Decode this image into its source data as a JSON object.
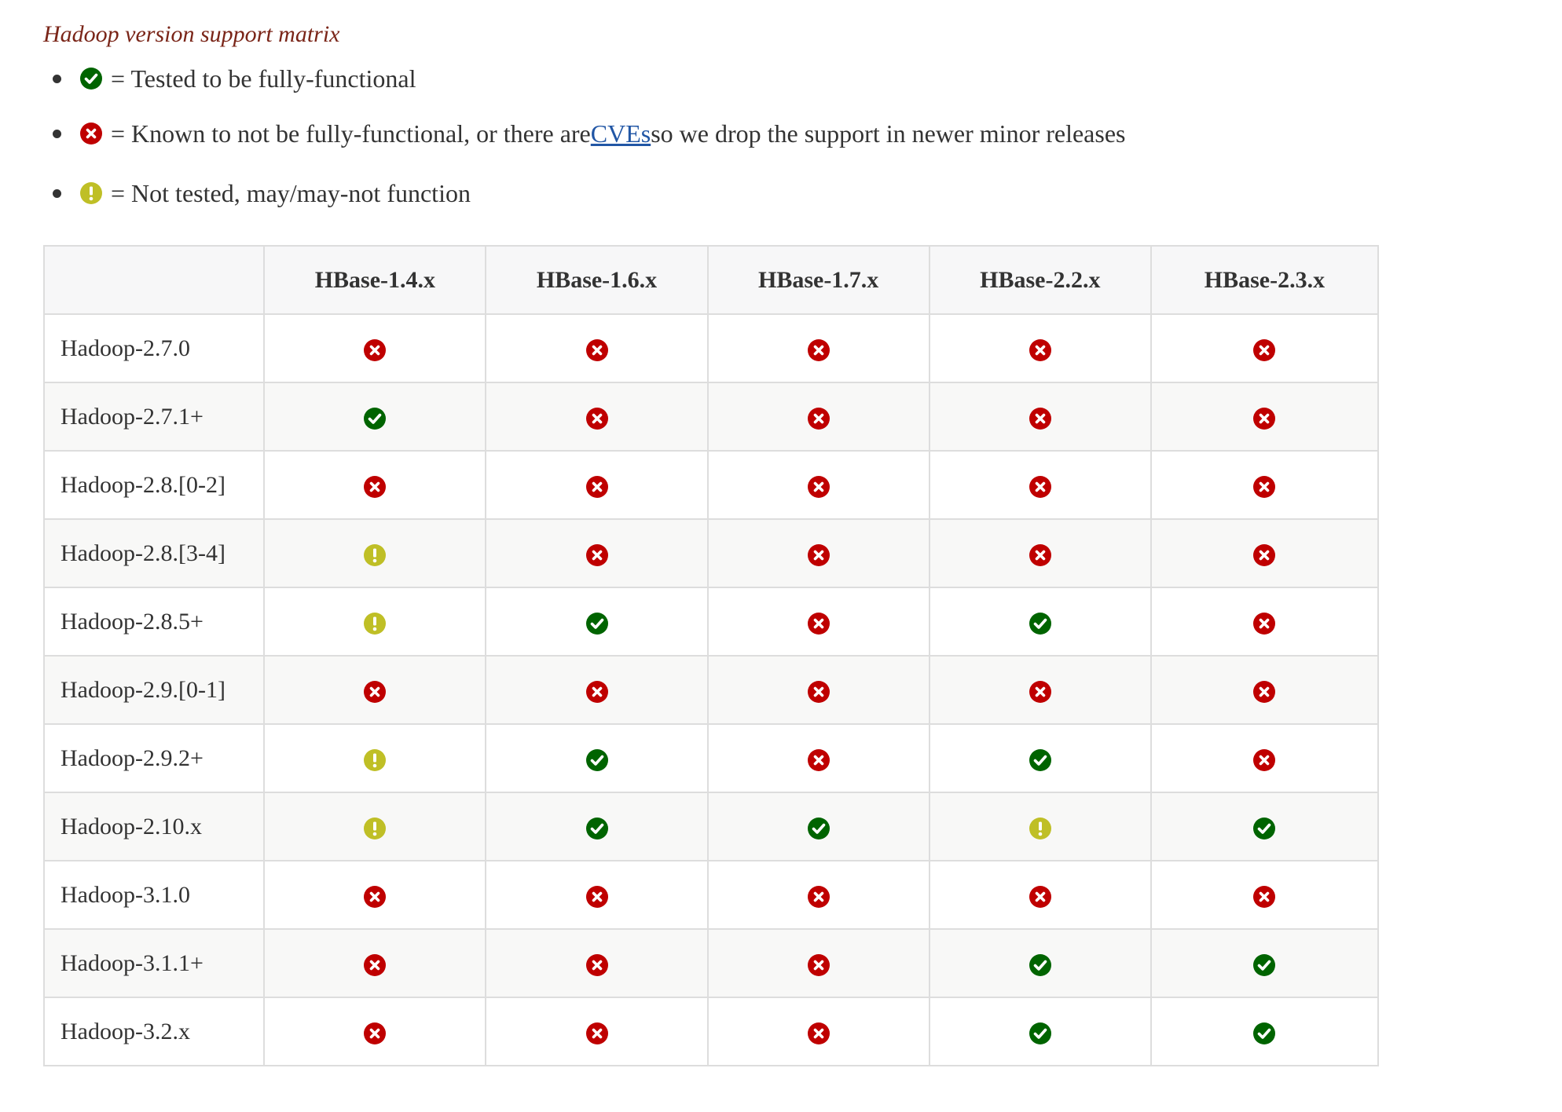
{
  "caption": "Hadoop version support matrix",
  "legend": [
    {
      "icon": "check-circle-icon",
      "pre": "= Tested to be fully-functional",
      "link": "",
      "post": ""
    },
    {
      "icon": "times-circle-icon",
      "pre": "= Known to not be fully-functional, or there are ",
      "link": "CVEs",
      "post": " so we drop the support in newer minor releases"
    },
    {
      "icon": "exclamation-circle-icon",
      "pre": "= Not tested, may/may-not function",
      "link": "",
      "post": ""
    }
  ],
  "colors": {
    "yes": "#006400",
    "no": "#bf0000",
    "untested": "#bfbf26",
    "caption": "#7a2518",
    "link": "#2156a5"
  },
  "table": {
    "columns": [
      "HBase-1.4.x",
      "HBase-1.6.x",
      "HBase-1.7.x",
      "HBase-2.2.x",
      "HBase-2.3.x"
    ],
    "rows": [
      {
        "label": "Hadoop-2.7.0",
        "cells": [
          "no",
          "no",
          "no",
          "no",
          "no"
        ]
      },
      {
        "label": "Hadoop-2.7.1+",
        "cells": [
          "yes",
          "no",
          "no",
          "no",
          "no"
        ]
      },
      {
        "label": "Hadoop-2.8.[0-2]",
        "cells": [
          "no",
          "no",
          "no",
          "no",
          "no"
        ]
      },
      {
        "label": "Hadoop-2.8.[3-4]",
        "cells": [
          "untested",
          "no",
          "no",
          "no",
          "no"
        ]
      },
      {
        "label": "Hadoop-2.8.5+",
        "cells": [
          "untested",
          "yes",
          "no",
          "yes",
          "no"
        ]
      },
      {
        "label": "Hadoop-2.9.[0-1]",
        "cells": [
          "no",
          "no",
          "no",
          "no",
          "no"
        ]
      },
      {
        "label": "Hadoop-2.9.2+",
        "cells": [
          "untested",
          "yes",
          "no",
          "yes",
          "no"
        ]
      },
      {
        "label": "Hadoop-2.10.x",
        "cells": [
          "untested",
          "yes",
          "yes",
          "untested",
          "yes"
        ]
      },
      {
        "label": "Hadoop-3.1.0",
        "cells": [
          "no",
          "no",
          "no",
          "no",
          "no"
        ]
      },
      {
        "label": "Hadoop-3.1.1+",
        "cells": [
          "no",
          "no",
          "no",
          "yes",
          "yes"
        ]
      },
      {
        "label": "Hadoop-3.2.x",
        "cells": [
          "no",
          "no",
          "no",
          "yes",
          "yes"
        ]
      }
    ]
  }
}
